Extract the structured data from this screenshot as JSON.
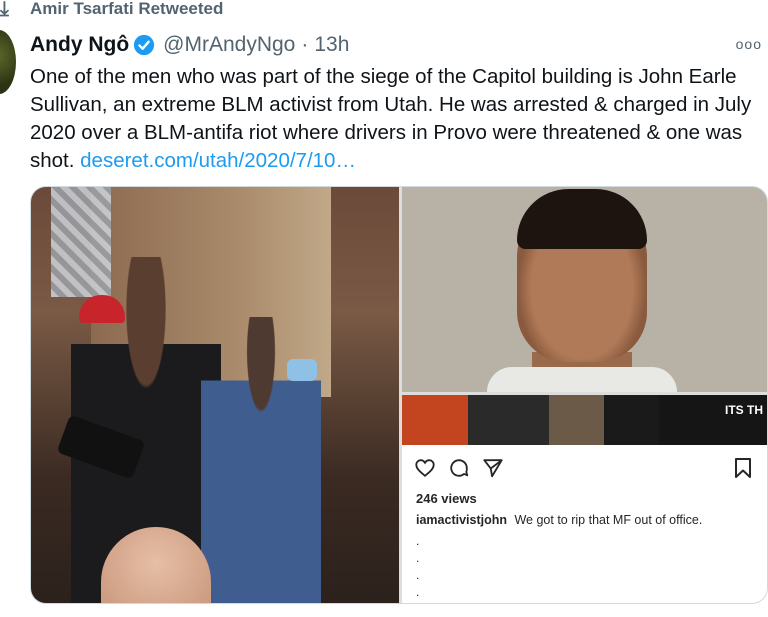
{
  "retweet": {
    "icon": "retweet-icon",
    "label": "Amir Tsarfati Retweeted"
  },
  "author": {
    "name": "Andy Ngô",
    "verified_icon": "verified-badge-icon",
    "handle": "@MrAndyNgo",
    "separator": "·",
    "time": "13h"
  },
  "more_label": "ooo",
  "tweet": {
    "text": "One of the men who was part of the siege of the Capitol building is John Earle Sullivan, an extreme BLM activist from Utah. He was arrested & charged in July 2020 over a BLM-antifa riot where drivers in Provo were threatened & one was shot.",
    "link": "deseret.com/utah/2020/7/10…"
  },
  "media": {
    "strip_text": "ITS TH",
    "instagram": {
      "icons": [
        "heart-icon",
        "comment-icon",
        "send-icon",
        "bookmark-icon"
      ],
      "views": "246 views",
      "username": "iamactivistjohn",
      "caption": "We got to rip that MF out of office.",
      "dots": [
        ".",
        ".",
        ".",
        "."
      ]
    }
  },
  "colors": {
    "link": "#1d9bf0",
    "secondary": "#536471",
    "verified": "#1d9bf0"
  }
}
